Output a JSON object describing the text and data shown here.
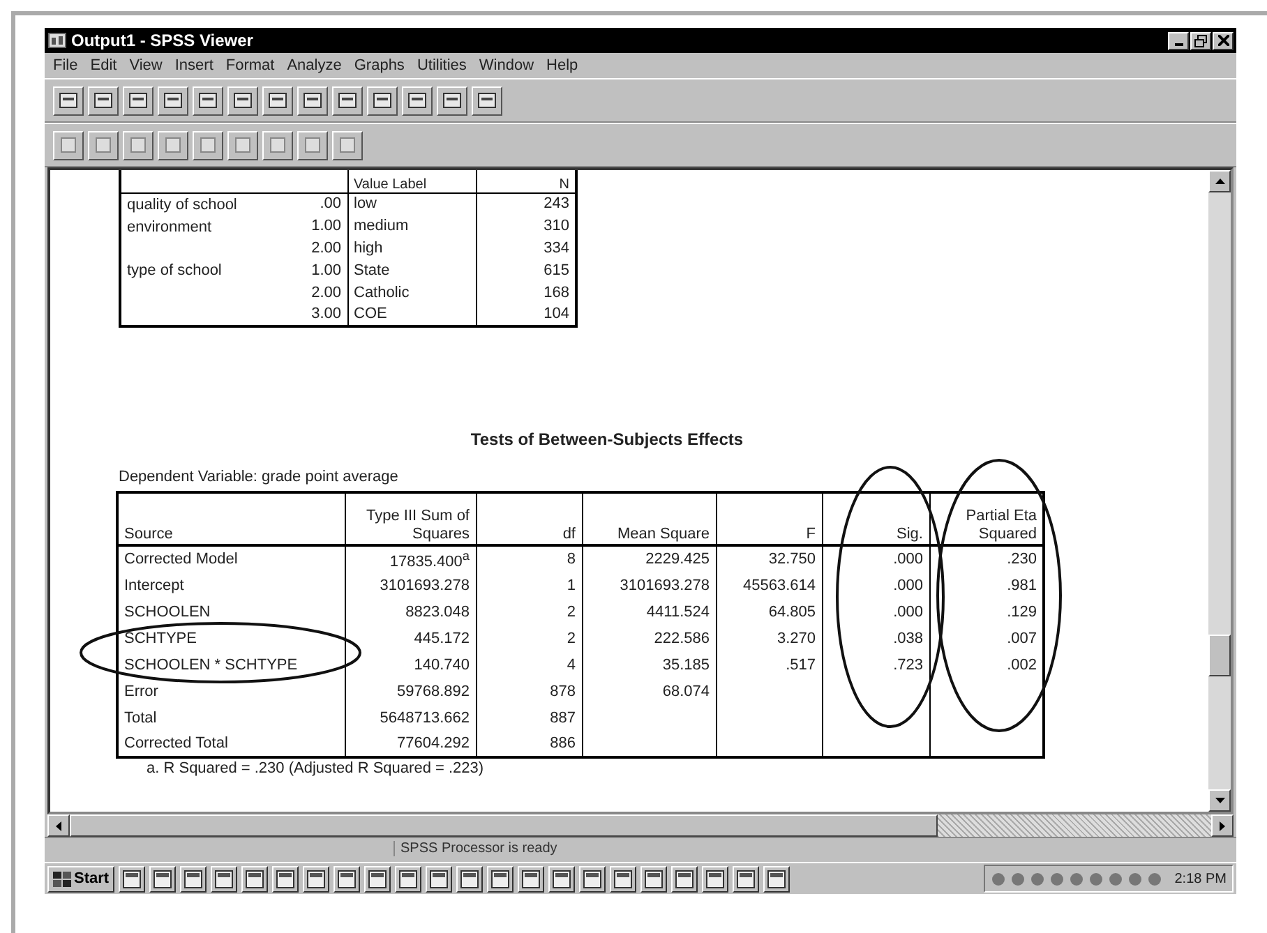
{
  "window": {
    "title": "Output1 - SPSS Viewer"
  },
  "menu": [
    "File",
    "Edit",
    "View",
    "Insert",
    "Format",
    "Analyze",
    "Graphs",
    "Utilities",
    "Window",
    "Help"
  ],
  "factors_table": {
    "columns": [
      "Value Label",
      "N"
    ],
    "factors": [
      {
        "name": "quality of school environment",
        "levels": [
          {
            "code": ".00",
            "category": "low",
            "n": "243"
          },
          {
            "code": "1.00",
            "category": "medium",
            "n": "310"
          },
          {
            "code": "2.00",
            "category": "high",
            "n": "334"
          }
        ]
      },
      {
        "name": "type of school",
        "levels": [
          {
            "code": "1.00",
            "category": "State",
            "n": "615"
          },
          {
            "code": "2.00",
            "category": "Catholic",
            "n": "168"
          },
          {
            "code": "3.00",
            "category": "COE",
            "n": "104"
          }
        ]
      }
    ]
  },
  "effects_table": {
    "title": "Tests of Between-Subjects Effects",
    "subtitle": "Dependent Variable: grade point average",
    "columns": [
      "Source",
      "Type III Sum of Squares",
      "df",
      "Mean Square",
      "F",
      "Sig.",
      "Partial Eta Squared"
    ],
    "rows": [
      [
        "Corrected Model",
        "17835.400$^{a}$",
        "8",
        "2229.425",
        "32.750",
        ".000",
        ".230"
      ],
      [
        "Intercept",
        "3101693.278",
        "1",
        "3101693.278",
        "45563.614",
        ".000",
        ".981"
      ],
      [
        "SCHOOLEN",
        "8823.048",
        "2",
        "4411.524",
        "64.805",
        ".000",
        ".129"
      ],
      [
        "SCHTYPE",
        "445.172",
        "2",
        "222.586",
        "3.270",
        ".038",
        ".007"
      ],
      [
        "SCHOOLEN * SCHTYPE",
        "140.740",
        "4",
        "35.185",
        ".517",
        ".723",
        ".002"
      ],
      [
        "Error",
        "59768.892",
        "878",
        "68.074",
        "",
        "",
        ""
      ],
      [
        "Total",
        "5648713.662",
        "887",
        "",
        "",
        "",
        ""
      ],
      [
        "Corrected Total",
        "77604.292",
        "886",
        "",
        "",
        "",
        ""
      ]
    ],
    "footnote": "a. R Squared = .230 (Adjusted R Squared = .223)"
  },
  "status_bar": "SPSS Processor  is ready",
  "taskbar": {
    "start": "Start",
    "time": "2:18 PM"
  }
}
